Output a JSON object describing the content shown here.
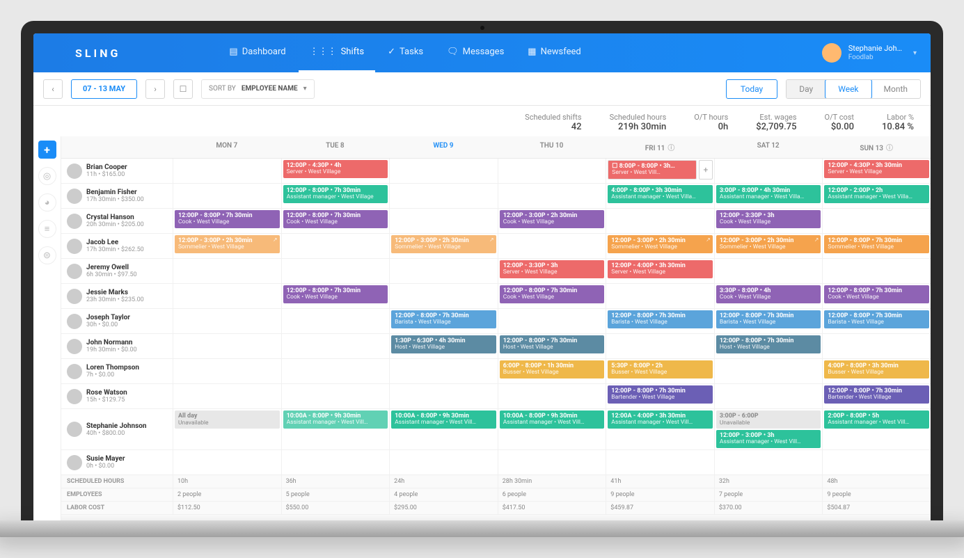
{
  "brand": "SLING",
  "nav": {
    "dashboard": "Dashboard",
    "shifts": "Shifts",
    "tasks": "Tasks",
    "messages": "Messages",
    "newsfeed": "Newsfeed"
  },
  "user": {
    "name": "Stephanie Joh…",
    "company": "Foodlab"
  },
  "toolbar": {
    "range": "07 - 13 MAY",
    "sort_label": "SORT BY",
    "sort_value": "EMPLOYEE NAME",
    "today": "Today",
    "views": {
      "day": "Day",
      "week": "Week",
      "month": "Month"
    }
  },
  "stats": {
    "scheduled_shifts": {
      "label": "Scheduled shifts",
      "value": "42"
    },
    "scheduled_hours": {
      "label": "Scheduled hours",
      "value": "219h 30min"
    },
    "ot_hours": {
      "label": "O/T hours",
      "value": "0h"
    },
    "est_wages": {
      "label": "Est. wages",
      "value": "$2,709.75"
    },
    "ot_cost": {
      "label": "O/T cost",
      "value": "$0.00"
    },
    "labor_pct": {
      "label": "Labor %",
      "value": "10.84 %"
    }
  },
  "days": [
    "MON 7",
    "TUE 8",
    "WED 9",
    "THU 10",
    "FRI 11",
    "SAT 12",
    "SUN 13"
  ],
  "today_index": 2,
  "info_days": [
    4,
    6
  ],
  "colors": {
    "server": "#ed6a6a",
    "assistant_manager": "#2dc29b",
    "cook": "#8f63b5",
    "sommelier": "#f5a34d",
    "host": "#5c8ba3",
    "barista": "#5ba4db",
    "busser": "#efb84a",
    "bartender": "#6b5fb5"
  },
  "employees": [
    {
      "name": "Brian Cooper",
      "sub": "11h • $165.00",
      "cells": [
        null,
        [
          {
            "time": "12:00P - 4:30P • 4h",
            "role": "Server • West Village",
            "color": "c-red"
          }
        ],
        null,
        null,
        [
          {
            "time": "8:00P - 8:00P • 3h…",
            "role": "Server • West Vill…",
            "color": "c-red",
            "addable": true,
            "bordered": true
          }
        ],
        null,
        [
          {
            "time": "12:00P - 4:30P • 3h 30min",
            "role": "Server • West Village",
            "color": "c-red"
          }
        ]
      ]
    },
    {
      "name": "Benjamin Fisher",
      "sub": "17h 30min • $350.00",
      "cells": [
        null,
        [
          {
            "time": "12:00P - 8:00P • 7h 30min",
            "role": "Assistant manager • West Village",
            "color": "c-green"
          }
        ],
        null,
        null,
        [
          {
            "time": "4:00P - 8:00P • 3h 30min",
            "role": "Assistant manager • West Villa…",
            "color": "c-green"
          }
        ],
        [
          {
            "time": "3:00P - 8:00P • 4h 30min",
            "role": "Assistant manager • West Villa…",
            "color": "c-green"
          }
        ],
        [
          {
            "time": "12:00P - 2:00P • 2h",
            "role": "Assistant manager • West Villa…",
            "color": "c-green"
          }
        ]
      ]
    },
    {
      "name": "Crystal Hanson",
      "sub": "20h 30min • $205.00",
      "cells": [
        [
          {
            "time": "12:00P - 8:00P • 7h 30min",
            "role": "Cook • West Village",
            "color": "c-purple"
          }
        ],
        [
          {
            "time": "12:00P - 8:00P • 7h 30min",
            "role": "Cook • West Village",
            "color": "c-purple"
          }
        ],
        null,
        [
          {
            "time": "12:00P - 3:00P • 2h 30min",
            "role": "Cook • West Village",
            "color": "c-purple"
          }
        ],
        null,
        [
          {
            "time": "12:00P - 3:30P • 3h",
            "role": "Cook • West Village",
            "color": "c-purple"
          }
        ],
        null
      ]
    },
    {
      "name": "Jacob Lee",
      "sub": "17h 30min • $262.50",
      "cells": [
        [
          {
            "time": "12:00P - 3:00P • 2h 30min",
            "role": "Sommelier • West Village",
            "color": "c-orange",
            "ext": true,
            "lt": true
          }
        ],
        null,
        [
          {
            "time": "12:00P - 3:00P • 2h 30min",
            "role": "Sommelier • West Village",
            "color": "c-orange",
            "ext": true,
            "lt": true
          }
        ],
        null,
        [
          {
            "time": "12:00P - 3:00P • 2h 30min",
            "role": "Sommelier • West Village",
            "color": "c-orange",
            "ext": true
          }
        ],
        [
          {
            "time": "12:00P - 3:00P • 2h 30min",
            "role": "Sommelier • West Village",
            "color": "c-orange",
            "ext": true
          }
        ],
        [
          {
            "time": "12:00P - 8:00P • 7h 30min",
            "role": "Sommelier • West Village",
            "color": "c-orange"
          }
        ]
      ]
    },
    {
      "name": "Jeremy Owell",
      "sub": "6h 30min • $97.50",
      "cells": [
        null,
        null,
        null,
        [
          {
            "time": "12:00P - 3:30P • 3h",
            "role": "Server • West Village",
            "color": "c-red"
          }
        ],
        [
          {
            "time": "12:00P - 4:00P • 3h 30min",
            "role": "Server • West Village",
            "color": "c-red"
          }
        ],
        null,
        null
      ]
    },
    {
      "name": "Jessie Marks",
      "sub": "23h 30min • $235.00",
      "cells": [
        null,
        [
          {
            "time": "12:00P - 8:00P • 7h 30min",
            "role": "Cook • West Village",
            "color": "c-purple"
          }
        ],
        null,
        [
          {
            "time": "12:00P - 8:00P • 7h 30min",
            "role": "Cook • West Village",
            "color": "c-purple"
          }
        ],
        null,
        [
          {
            "time": "3:30P - 8:00P • 4h",
            "role": "Cook • West Village",
            "color": "c-purple"
          }
        ],
        [
          {
            "time": "12:00P - 8:00P • 7h 30min",
            "role": "Cook • West Village",
            "color": "c-purple"
          }
        ]
      ]
    },
    {
      "name": "Joseph Taylor",
      "sub": "30h • $0.00",
      "cells": [
        null,
        null,
        [
          {
            "time": "12:00P - 8:00P • 7h 30min",
            "role": "Barista • West Village",
            "color": "c-blue"
          }
        ],
        null,
        [
          {
            "time": "12:00P - 8:00P • 7h 30min",
            "role": "Barista • West Village",
            "color": "c-blue"
          }
        ],
        [
          {
            "time": "12:00P - 8:00P • 7h 30min",
            "role": "Barista • West Village",
            "color": "c-blue"
          }
        ],
        [
          {
            "time": "12:00P - 8:00P • 7h 30min",
            "role": "Barista • West Village",
            "color": "c-blue"
          }
        ]
      ]
    },
    {
      "name": "John Normann",
      "sub": "19h 30min • $0.00",
      "cells": [
        null,
        null,
        [
          {
            "time": "1:30P - 6:30P • 4h 30min",
            "role": "Host • West Village",
            "color": "c-teal"
          }
        ],
        [
          {
            "time": "12:00P - 8:00P • 7h 30min",
            "role": "Host • West Village",
            "color": "c-teal"
          }
        ],
        null,
        [
          {
            "time": "12:00P - 8:00P • 7h 30min",
            "role": "Host • West Village",
            "color": "c-teal"
          }
        ],
        null
      ]
    },
    {
      "name": "Loren Thompson",
      "sub": "7h • $0.00",
      "cells": [
        null,
        null,
        null,
        [
          {
            "time": "6:00P - 8:00P • 1h 30min",
            "role": "Busser • West Village",
            "color": "c-yellow"
          }
        ],
        [
          {
            "time": "5:30P - 8:00P • 2h",
            "role": "Busser • West Village",
            "color": "c-yellow"
          }
        ],
        null,
        [
          {
            "time": "4:00P - 8:00P • 3h 30min",
            "role": "Busser • West Village",
            "color": "c-yellow"
          }
        ]
      ]
    },
    {
      "name": "Rose Watson",
      "sub": "15h • $129.75",
      "cells": [
        null,
        null,
        null,
        null,
        [
          {
            "time": "12:00P - 8:00P • 7h 30min",
            "role": "Bartender • West Village",
            "color": "c-indigo"
          }
        ],
        null,
        [
          {
            "time": "12:00P - 8:00P • 7h 30min",
            "role": "Bartender • West Village",
            "color": "c-indigo"
          }
        ]
      ]
    },
    {
      "name": "Stephanie Johnson",
      "sub": "40h • $800.00",
      "cells": [
        [
          {
            "unav": true,
            "time": "All day",
            "role": "Unavailable"
          }
        ],
        [
          {
            "time": "10:00A - 8:00P • 9h 30min",
            "role": "Assistant manager • West Vill…",
            "color": "c-green",
            "lt": true
          }
        ],
        [
          {
            "time": "10:00A - 8:00P • 9h 30min",
            "role": "Assistant manager • West Vill…",
            "color": "c-green"
          }
        ],
        [
          {
            "time": "10:00A - 8:00P • 9h 30min",
            "role": "Assistant manager • West Vill…",
            "color": "c-green"
          }
        ],
        [
          {
            "time": "12:00A - 4:00P • 3h 30min",
            "role": "Assistant manager • West Vill…",
            "color": "c-green"
          }
        ],
        [
          {
            "unav": true,
            "time": "3:00P - 6:00P",
            "role": "Unavailable"
          },
          {
            "time": "12:00P - 3:00P • 3h",
            "role": "Assistant manager • West Vill…",
            "color": "c-green"
          }
        ],
        [
          {
            "time": "2:00P - 8:00P • 5h",
            "role": "Assistant manager • West Vill…",
            "color": "c-green"
          }
        ]
      ]
    },
    {
      "name": "Susie Mayer",
      "sub": "0h • $0.00",
      "cells": [
        null,
        null,
        null,
        null,
        null,
        null,
        null
      ]
    }
  ],
  "totals": {
    "rows": [
      {
        "label": "SCHEDULED HOURS",
        "cells": [
          "10h",
          "36h",
          "24h",
          "28h 30min",
          "41h",
          "32h",
          "48h"
        ]
      },
      {
        "label": "EMPLOYEES",
        "cells": [
          "2 people",
          "5 people",
          "4 people",
          "6 people",
          "9 people",
          "7 people",
          "9 people"
        ]
      },
      {
        "label": "LABOR COST",
        "cells": [
          "$112.50",
          "$550.00",
          "$295.00",
          "$417.50",
          "$459.87",
          "$370.00",
          "$504.87"
        ]
      }
    ]
  }
}
